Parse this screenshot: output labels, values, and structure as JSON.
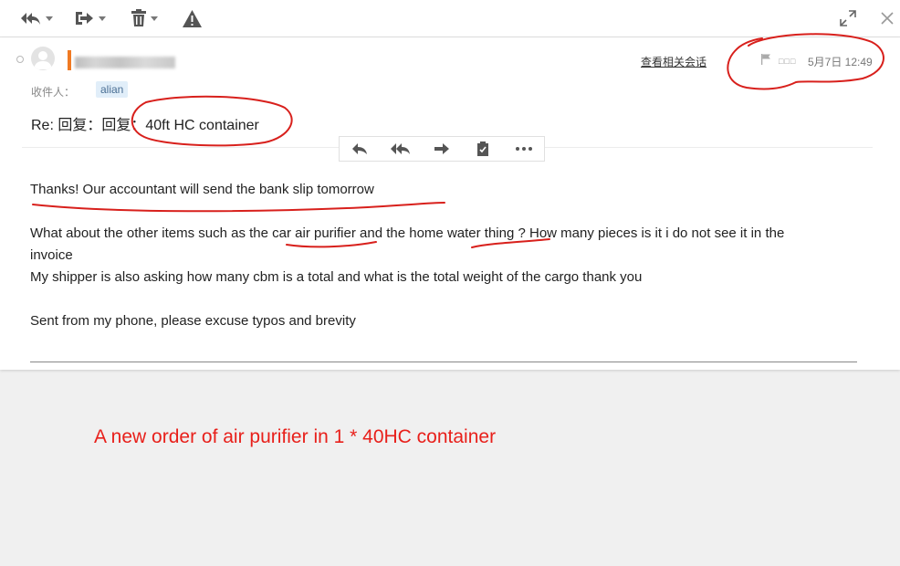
{
  "toolbar": {
    "icons": [
      "reply-all-icon",
      "move-to-icon",
      "delete-icon",
      "report-icon",
      "expand-icon",
      "close-icon"
    ]
  },
  "email": {
    "view_conversation": "查看相关会话",
    "status_boxes": "□□□",
    "date": "5月7日 12:49",
    "recipient_label": "收件人：",
    "recipient": "alian",
    "subject_prefix": "Re: 回复：回复：",
    "subject_rest": "40ft HC container",
    "body": {
      "line1": "Thanks! Our accountant will send the bank slip tomorrow",
      "para2_a": "What about the other items such as the ",
      "para2_b": "car air purifier",
      "para2_c": " and the home ",
      "para2_d": "water thing",
      "para2_e": " ? How many pieces is it i do not see it in the",
      "para2_wrap": "invoice",
      "line3": "My shipper is also asking how many cbm is a total and what is the total weight of the cargo thank you",
      "signature": "Sent from my phone, please excuse typos and brevity"
    }
  },
  "annotation": {
    "caption": "A new order of air purifier in  1 * 40HC container",
    "color": "#e8201b"
  },
  "colors": {
    "accent_bar": "#f07a23",
    "chip_bg": "#e1eef9",
    "annotation": "#d8201c"
  }
}
